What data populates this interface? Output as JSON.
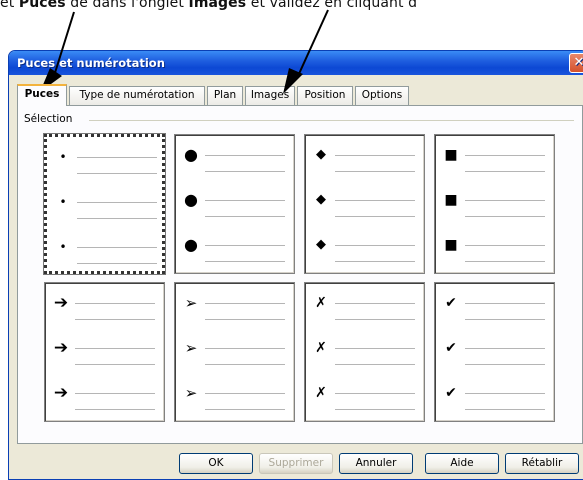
{
  "instruction": {
    "before": "et ",
    "bold1": "Puces",
    "middle": " de dans l'onglet ",
    "bold2": "Images",
    "after": " et validez en cliquant d"
  },
  "dialog": {
    "title": "Puces et numérotation",
    "close_glyph": "✕",
    "tabs": [
      "Puces",
      "Type de numérotation",
      "Plan",
      "Images",
      "Position",
      "Options"
    ],
    "active_tab": "Puces",
    "group_label": "Sélection",
    "bullets": [
      {
        "name": "small-dot",
        "glyph": "•",
        "selected": true
      },
      {
        "name": "large-dot",
        "glyph": "●",
        "selected": false
      },
      {
        "name": "diamond",
        "glyph": "◆",
        "selected": false
      },
      {
        "name": "square",
        "glyph": "■",
        "selected": false
      },
      {
        "name": "arrow",
        "glyph": "➔",
        "selected": false
      },
      {
        "name": "arrowhead",
        "glyph": "➢",
        "selected": false
      },
      {
        "name": "cross",
        "glyph": "✗",
        "selected": false
      },
      {
        "name": "checkmark",
        "glyph": "✔",
        "selected": false
      }
    ],
    "buttons": {
      "ok": "OK",
      "delete": "Supprimer",
      "cancel": "Annuler",
      "help": "Aide",
      "reset": "Rétablir"
    }
  }
}
